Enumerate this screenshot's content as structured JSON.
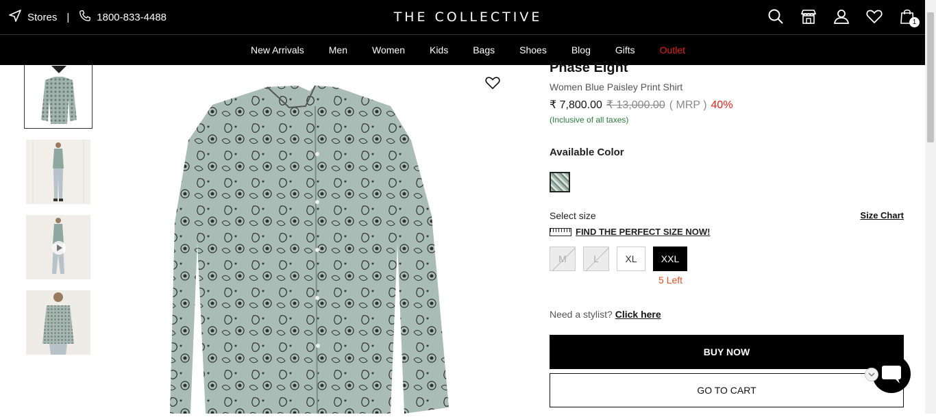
{
  "topbar": {
    "stores_label": "Stores",
    "separator": "|",
    "phone": "1800-833-4488",
    "brand": "THE COLLECTIVE",
    "cart_count": "1"
  },
  "nav": {
    "items": [
      "New Arrivals",
      "Men",
      "Women",
      "Kids",
      "Bags",
      "Shoes",
      "Blog",
      "Gifts",
      "Outlet"
    ],
    "accent_color": "#e2231a"
  },
  "product": {
    "brand": "Phase Eight",
    "name": "Women Blue Paisley Print Shirt",
    "price": "₹ 7,800.00",
    "mrp_value": "₹ 13,000.00",
    "mrp_label": "( MRP )",
    "discount": "40%",
    "tax_note": "(Inclusive of all taxes)",
    "available_color_label": "Available Color",
    "select_size_label": "Select size",
    "size_chart_label": "Size Chart",
    "find_size_label": "FIND THE PERFECT SIZE NOW!",
    "sizes": [
      {
        "label": "M",
        "available": false
      },
      {
        "label": "L",
        "available": false
      },
      {
        "label": "XL",
        "available": true
      },
      {
        "label": "XXL",
        "available": true,
        "selected": true
      }
    ],
    "stock_note": "5 Left",
    "stylist_text": "Need a stylist?",
    "stylist_link": "Click here",
    "buy_now_label": "BUY NOW",
    "go_to_cart_label": "GO TO CART"
  }
}
